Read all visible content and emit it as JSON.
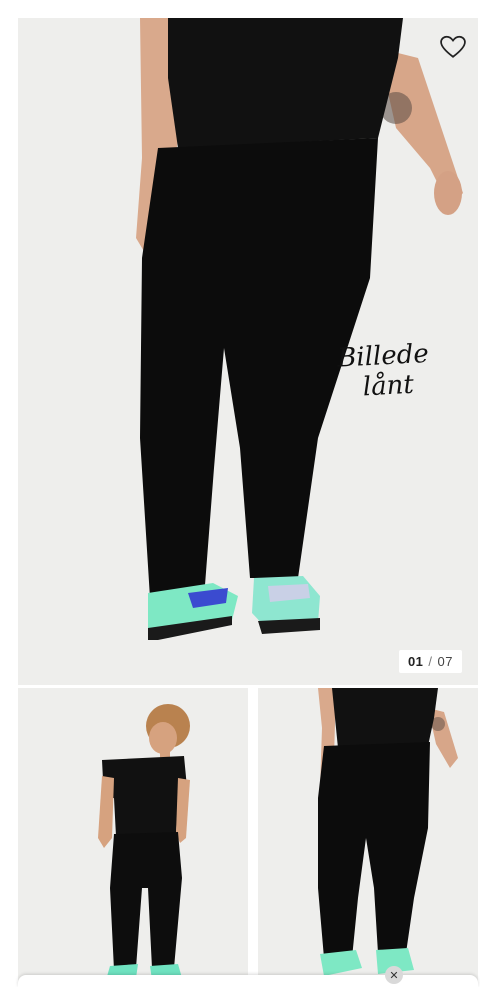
{
  "gallery": {
    "current": "01",
    "separator": "/",
    "total": "07"
  },
  "annotation": {
    "line1": "Billede",
    "line2": "lånt"
  },
  "icons": {
    "favorite": "heart-icon",
    "close": "close-icon"
  },
  "colors": {
    "background": "#eeeeec",
    "garment": "#0d0d0d",
    "sneaker_accent": "#5ee3b0"
  }
}
